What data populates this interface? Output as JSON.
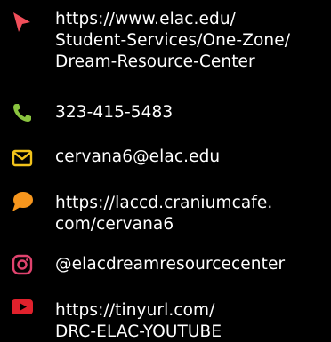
{
  "links": [
    {
      "icon": "cursor-arrow-icon",
      "color": "#f04e5a",
      "lines": [
        "https://www.elac.edu/",
        "Student-Services/One-Zone/",
        "Dream-Resource-Center"
      ]
    },
    {
      "icon": "phone-icon",
      "color": "#8ac43f",
      "lines": [
        "323-415-5483"
      ]
    },
    {
      "icon": "mail-icon",
      "color": "#f2c31b",
      "lines": [
        "cervana6@elac.edu"
      ]
    },
    {
      "icon": "chat-bubble-icon",
      "color": "#f7961d",
      "lines": [
        "https://laccd.craniumcafe.",
        "com/cervana6"
      ]
    },
    {
      "icon": "instagram-icon",
      "color": "#e0436e",
      "lines": [
        "@elacdreamresourcecenter"
      ]
    },
    {
      "icon": "youtube-icon",
      "color": "#e0212c",
      "lines": [
        "https://tinyurl.com/",
        "DRC-ELAC-YOUTUBE"
      ]
    }
  ]
}
